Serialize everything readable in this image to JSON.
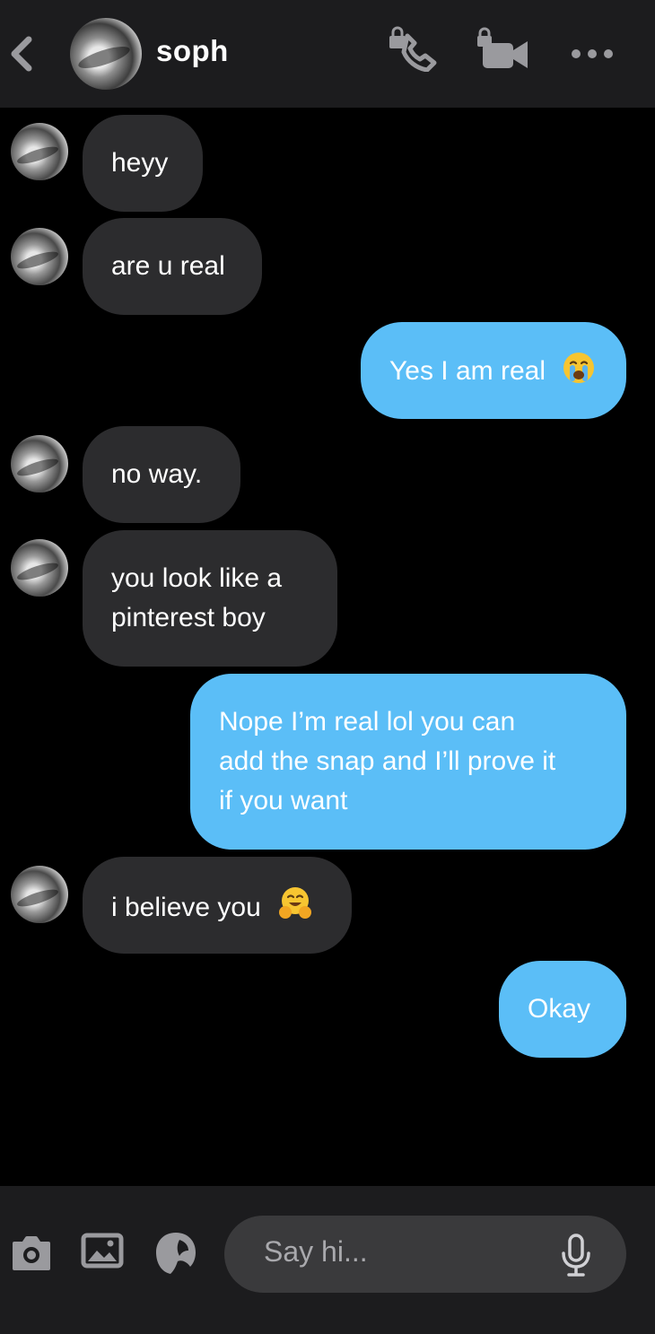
{
  "header": {
    "contact_name": "soph",
    "icons": [
      "back-chevron-icon",
      "phone-lock-icon",
      "video-lock-icon",
      "more-dots-icon"
    ]
  },
  "messages": [
    {
      "from": "them",
      "text": "heyy"
    },
    {
      "from": "them",
      "text": "are u real"
    },
    {
      "from": "me",
      "text": "Yes I am real",
      "emoji": "crying-face"
    },
    {
      "from": "them",
      "text": "no way."
    },
    {
      "from": "them",
      "line1": "you look like a",
      "line2": "pinterest boy"
    },
    {
      "from": "me",
      "line1": "Nope I’m real lol you can",
      "line2": "add the snap and I’ll prove it",
      "line3": "if you want"
    },
    {
      "from": "them",
      "text": "i believe you",
      "emoji": "hugging-face"
    },
    {
      "from": "me",
      "text": "Okay"
    }
  ],
  "composer": {
    "placeholder": "Say hi...",
    "icons": [
      "camera-icon",
      "gallery-icon",
      "sticker-icon",
      "microphone-icon"
    ]
  },
  "colors": {
    "background": "#000000",
    "bar": "#1c1c1e",
    "incoming_bubble": "#2c2c2e",
    "outgoing_bubble": "#5bbef7",
    "icon_gray": "#9a9a9e"
  }
}
